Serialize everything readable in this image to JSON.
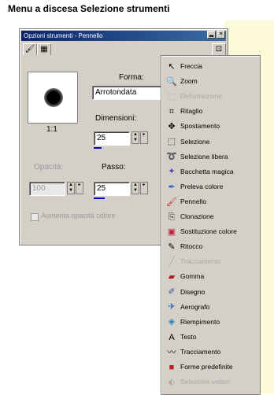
{
  "caption": "Menu a discesa Selezione strumenti",
  "window": {
    "title": "Opzioni strumenti - Pennello",
    "tabs": [
      "brush-icon",
      "grid-icon"
    ],
    "preview_label": "1:1",
    "forma_label": "Forma:",
    "forma_value": "Arrotondata",
    "dimensioni_label": "Dimensioni:",
    "dimensioni_value": "25",
    "opacita_label": "Opacità:",
    "opacita_value": "100",
    "passo_label": "Passo:",
    "passo_value": "25",
    "checkbox_label": "Aumenta opacità colore"
  },
  "dropdown": {
    "items": [
      {
        "label": "Freccia",
        "icon": "arrow-icon",
        "dim": false
      },
      {
        "label": "Zoom",
        "icon": "zoom-icon",
        "dim": false
      },
      {
        "label": "Deformazione",
        "icon": "deform-icon",
        "dim": true
      },
      {
        "label": "Ritaglio",
        "icon": "crop-icon",
        "dim": false
      },
      {
        "label": "Spostamento",
        "icon": "move-icon",
        "dim": false
      },
      {
        "label": "Selezione",
        "icon": "selection-icon",
        "dim": false
      },
      {
        "label": "Selezione libera",
        "icon": "lasso-icon",
        "dim": false
      },
      {
        "label": "Bacchetta magica",
        "icon": "magic-wand-icon",
        "dim": false
      },
      {
        "label": "Preleva colore",
        "icon": "eyedropper-icon",
        "dim": false
      },
      {
        "label": "Pennello",
        "icon": "brush-icon",
        "dim": false
      },
      {
        "label": "Clonazione",
        "icon": "clone-icon",
        "dim": false
      },
      {
        "label": "Sostituzione colore",
        "icon": "replace-color-icon",
        "dim": false
      },
      {
        "label": "Ritocco",
        "icon": "retouch-icon",
        "dim": false
      },
      {
        "label": "Tracciamento",
        "icon": "line-icon",
        "dim": true
      },
      {
        "label": "Gomma",
        "icon": "eraser-icon",
        "dim": false
      },
      {
        "label": "Disegno",
        "icon": "draw-icon",
        "dim": false
      },
      {
        "label": "Aerografo",
        "icon": "airbrush-icon",
        "dim": false
      },
      {
        "label": "Riempimento",
        "icon": "fill-icon",
        "dim": false
      },
      {
        "label": "Testo",
        "icon": "text-icon",
        "dim": false
      },
      {
        "label": "Tracciamento",
        "icon": "trace-icon",
        "dim": false
      },
      {
        "label": "Forme predefinite",
        "icon": "shapes-icon",
        "dim": false
      },
      {
        "label": "Selezione vettori",
        "icon": "vector-select-icon",
        "dim": true
      }
    ]
  }
}
